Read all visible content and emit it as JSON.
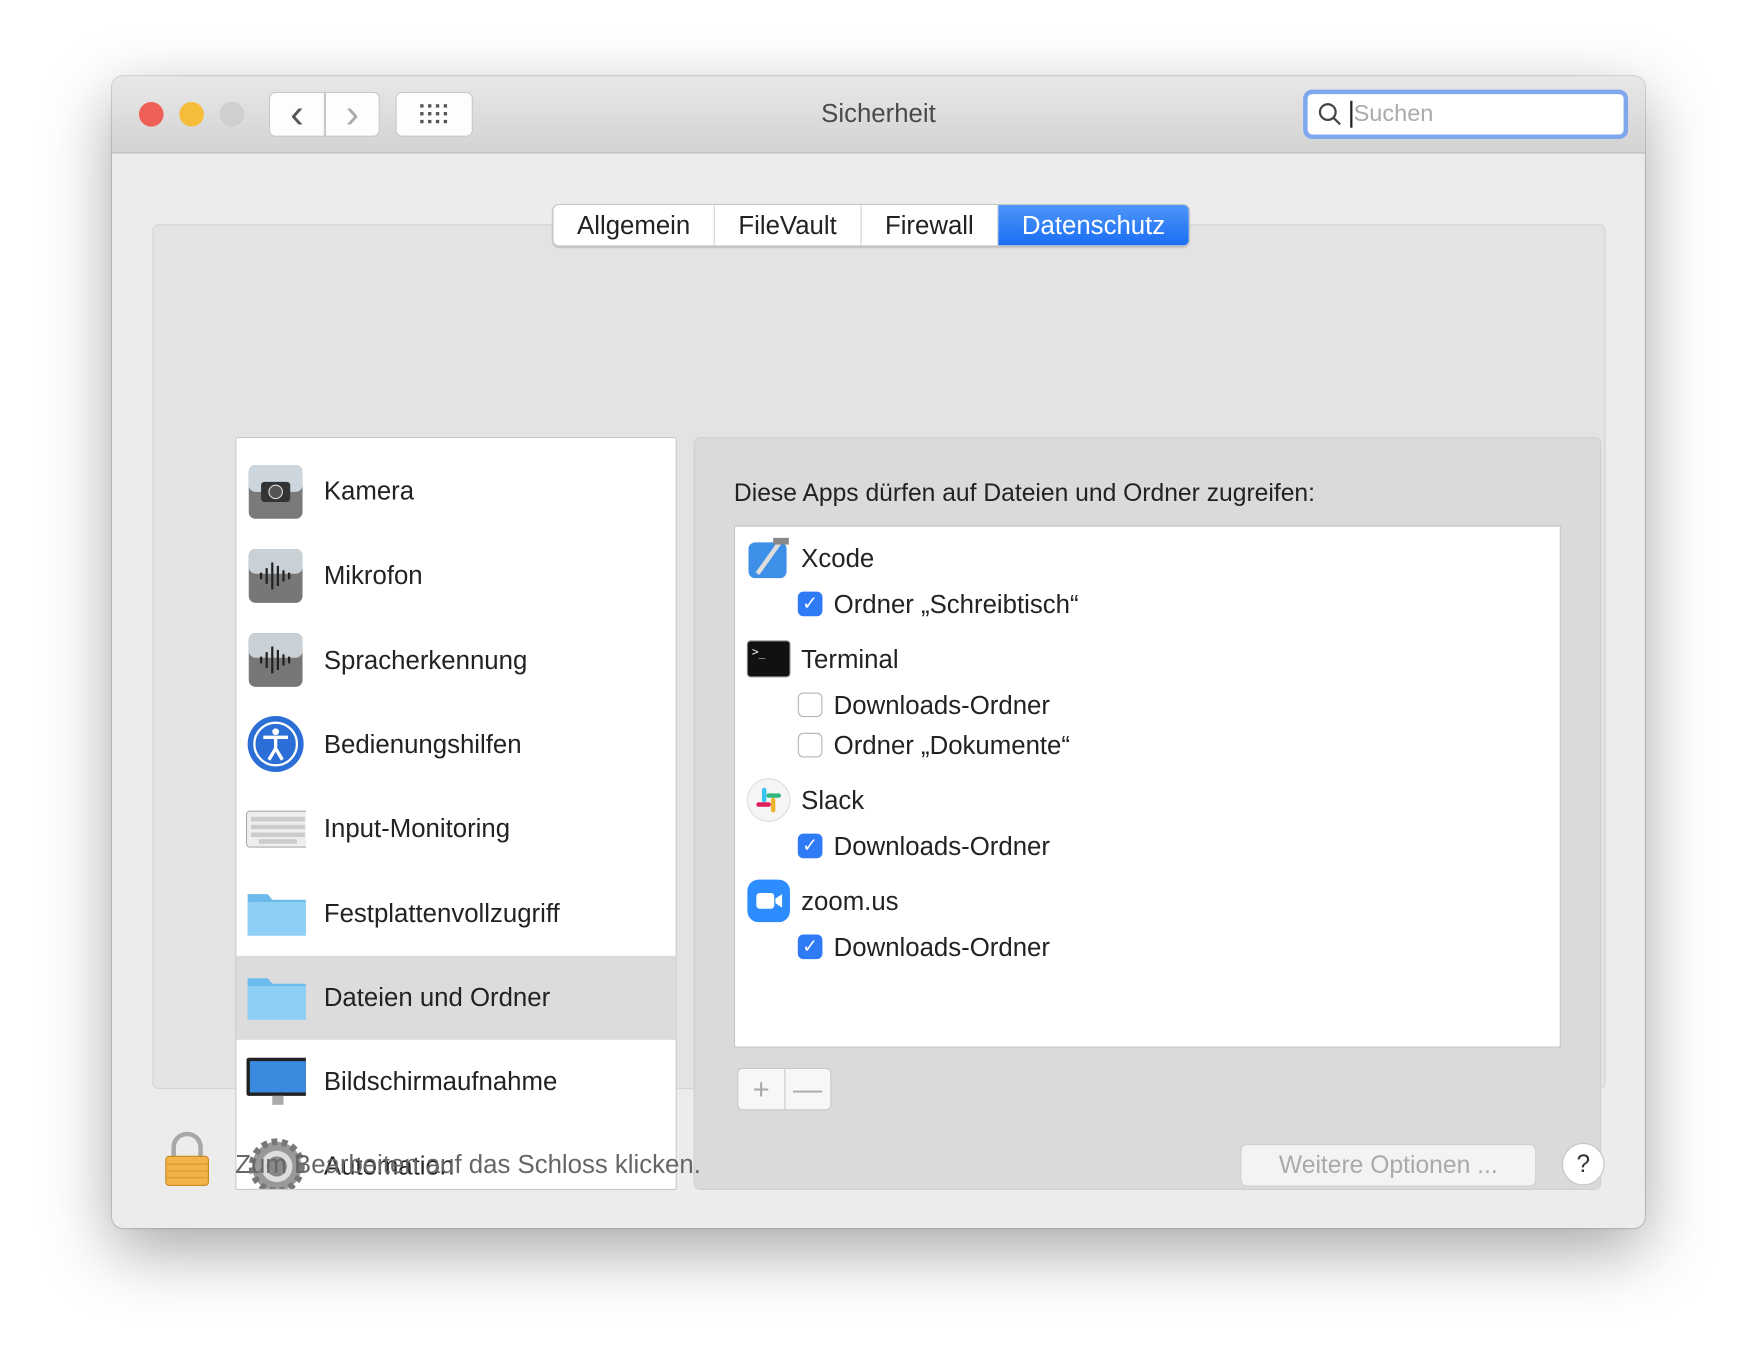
{
  "window": {
    "title": "Sicherheit"
  },
  "toolbar": {
    "back": "‹",
    "forward": "›",
    "search_placeholder": "Suchen"
  },
  "tabs": [
    {
      "label": "Allgemein"
    },
    {
      "label": "FileVault"
    },
    {
      "label": "Firewall"
    },
    {
      "label": "Datenschutz",
      "active": true
    }
  ],
  "sidebar": {
    "items": [
      {
        "label": "Kamera",
        "icon": "camera-icon"
      },
      {
        "label": "Mikrofon",
        "icon": "microphone-icon"
      },
      {
        "label": "Spracherkennung",
        "icon": "speech-icon"
      },
      {
        "label": "Bedienungshilfen",
        "icon": "accessibility-icon"
      },
      {
        "label": "Input-Monitoring",
        "icon": "keyboard-icon"
      },
      {
        "label": "Festplattenvollzugriff",
        "icon": "folder-icon"
      },
      {
        "label": "Dateien und Ordner",
        "icon": "folder-icon",
        "selected": true
      },
      {
        "label": "Bildschirmaufnahme",
        "icon": "display-icon"
      },
      {
        "label": "Automation",
        "icon": "gear-icon"
      }
    ]
  },
  "panel": {
    "heading": "Diese Apps dürfen auf Dateien und Ordner zugreifen:",
    "apps": [
      {
        "name": "Xcode",
        "perms": [
          {
            "label": "Ordner „Schreibtisch“",
            "checked": true
          }
        ]
      },
      {
        "name": "Terminal",
        "perms": [
          {
            "label": "Downloads-Ordner",
            "checked": false
          },
          {
            "label": "Ordner „Dokumente“",
            "checked": false
          }
        ]
      },
      {
        "name": "Slack",
        "perms": [
          {
            "label": "Downloads-Ordner",
            "checked": true
          }
        ]
      },
      {
        "name": "zoom.us",
        "perms": [
          {
            "label": "Downloads-Ordner",
            "checked": true
          }
        ]
      }
    ],
    "add": "+",
    "remove": "—"
  },
  "footer": {
    "lock_text": "Zum Bearbeiten auf das Schloss klicken.",
    "more_options": "Weitere Optionen ...",
    "help": "?"
  },
  "colors": {
    "accent": "#1a6ef5",
    "close": "#ee5f57",
    "minimize": "#f6bd3b"
  }
}
